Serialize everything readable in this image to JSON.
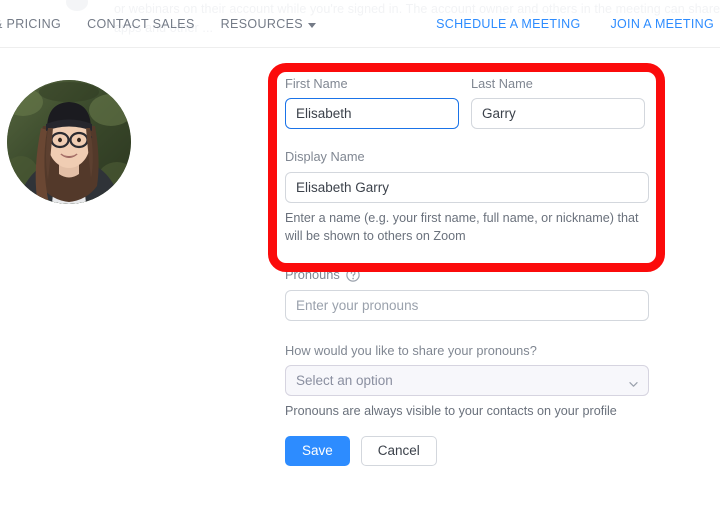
{
  "background_text": {
    "line1": "or webinars on their account while you're signed in. The account owner and others in the meeting can share t",
    "line2": "apps and other ..."
  },
  "navbar": {
    "left_items": [
      {
        "label": "& PRICING",
        "icon": ""
      },
      {
        "label": "CONTACT SALES",
        "icon": ""
      },
      {
        "label": "RESOURCES",
        "icon": "chevron-down-icon"
      }
    ],
    "right_items": [
      {
        "label": "SCHEDULE A MEETING"
      },
      {
        "label": "JOIN A MEETING"
      }
    ]
  },
  "profile": {
    "avatar_alt": "user-profile-photo",
    "first_name": {
      "label": "First Name",
      "value": "Elisabeth",
      "placeholder": "First Name"
    },
    "last_name": {
      "label": "Last Name",
      "value": "Garry",
      "placeholder": "Last Name"
    },
    "display_name": {
      "label": "Display Name",
      "value": "Elisabeth Garry",
      "placeholder": "Display Name",
      "helper": "Enter a name (e.g. your first name, full name, or nickname) that will be shown to others on Zoom"
    },
    "pronouns": {
      "label": "Pronouns",
      "help_icon": "question-mark-circle-icon",
      "value": "",
      "placeholder": "Enter your pronouns"
    },
    "pronoun_sharing": {
      "label": "How would you like to share your pronouns?",
      "selected": "Select an option",
      "chevron_icon": "chevron-down-icon",
      "helper": "Pronouns are always visible to your contacts on your profile"
    },
    "actions": {
      "save_label": "Save",
      "cancel_label": "Cancel"
    }
  },
  "annotation": {
    "shape": "rounded-rectangle-highlight",
    "color": "#fb0b0b"
  },
  "colors": {
    "accent_blue": "#2d8cff",
    "focus_blue": "#1a73e8",
    "annotation_red": "#fb0b0b",
    "label_gray": "#808792",
    "text_dark": "#3c424b"
  }
}
